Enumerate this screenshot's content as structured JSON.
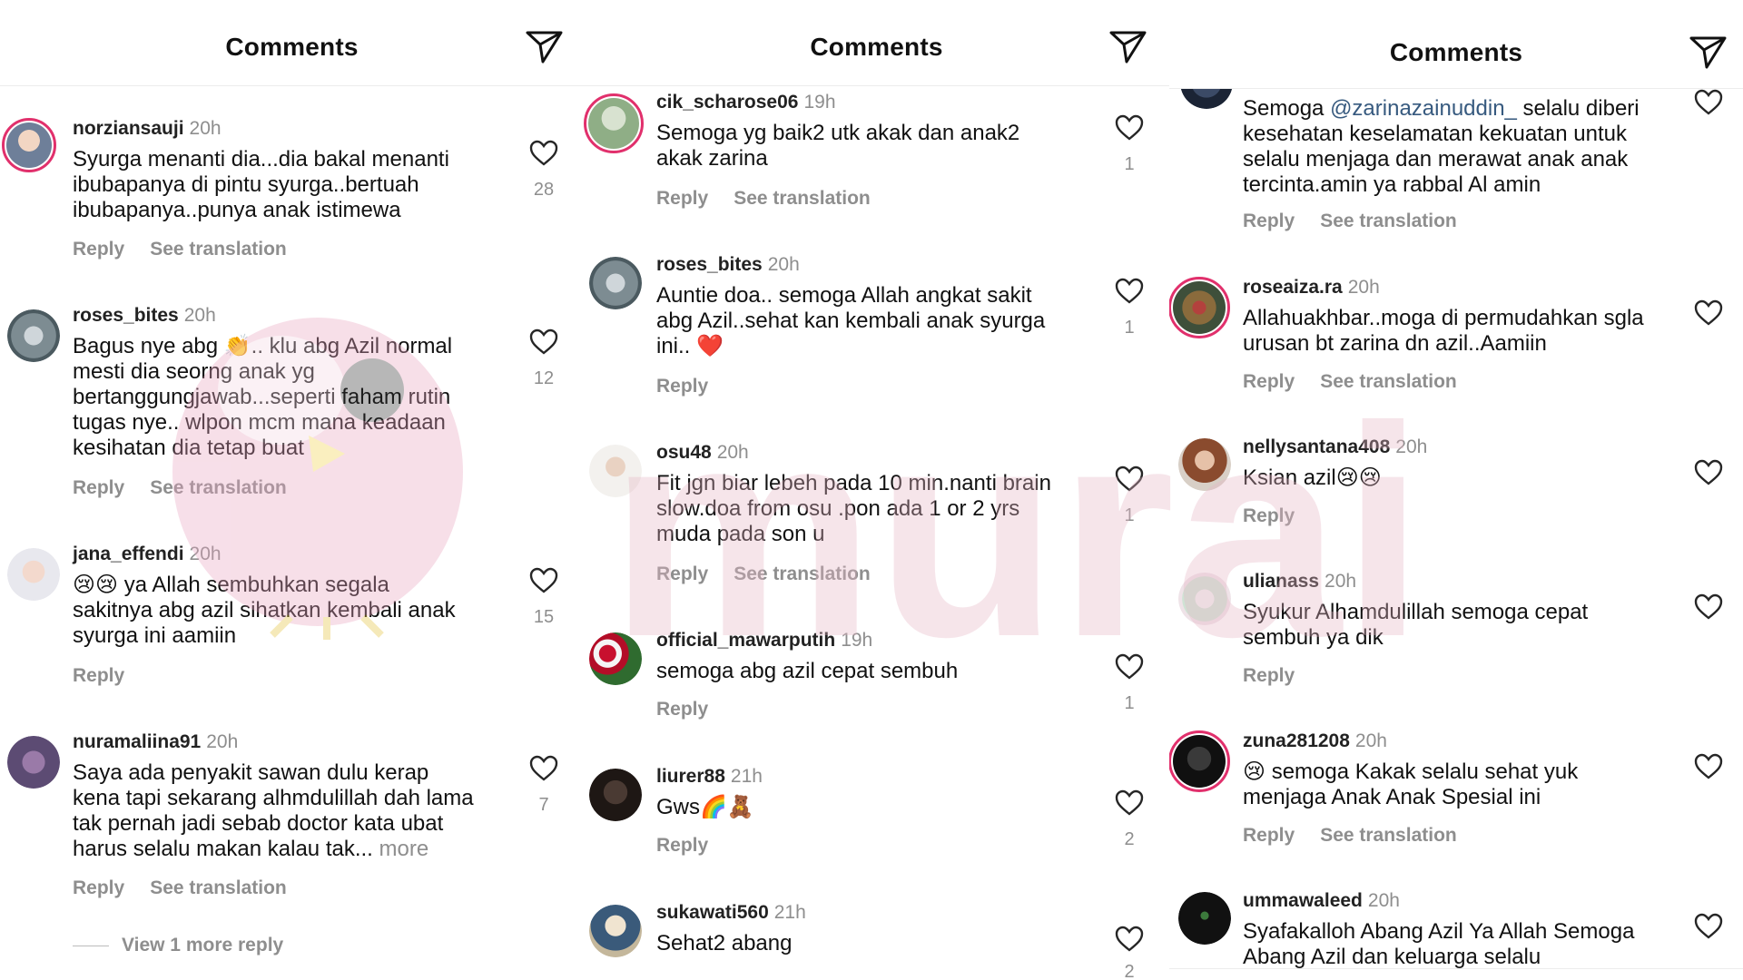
{
  "panels": [
    {
      "title": "Comments",
      "comments": [
        {
          "username": "norziansauji",
          "time": "20h",
          "text": [
            "Syurga menanti dia...dia bakal menanti",
            "ibubapanya di pintu syurga..bertuah",
            "ibubapanya..punya anak istimewa"
          ],
          "reply": "Reply",
          "translate": "See translation",
          "likes": "28"
        },
        {
          "username": "roses_bites",
          "time": "20h",
          "text": [
            "Bagus nye abg 👏.. klu abg Azil normal",
            "mesti dia seorng anak yg",
            "bertanggungjawab...seperti faham rutin",
            "tugas nye.. wlpon mcm mana keadaan",
            "kesihatan dia tetap buat"
          ],
          "reply": "Reply",
          "translate": "See translation",
          "likes": "12"
        },
        {
          "username": "jana_effendi",
          "time": "20h",
          "text": [
            "😢😢 ya Allah sembuhkan segala",
            "sakitnya abg azil sihatkan kembali anak",
            "syurga ini aamiin"
          ],
          "reply": "Reply",
          "translate": "",
          "likes": "15"
        },
        {
          "username": "nuramaliina91",
          "time": "20h",
          "text": [
            "Saya ada penyakit sawan dulu kerap",
            "kena tapi sekarang alhmdulillah dah lama",
            "tak pernah jadi sebab doctor kata ubat",
            "harus selalu makan kalau tak..."
          ],
          "more": "more",
          "reply": "Reply",
          "translate": "See translation",
          "likes": "7"
        }
      ],
      "view_more": "View 1 more reply"
    },
    {
      "title": "Comments",
      "comments": [
        {
          "username": "cik_scharose06",
          "time": "19h",
          "text": [
            "Semoga yg baik2 utk akak dan anak2",
            "akak zarina"
          ],
          "reply": "Reply",
          "translate": "See translation",
          "likes": "1"
        },
        {
          "username": "roses_bites",
          "time": "20h",
          "text": [
            "Auntie doa.. semoga Allah angkat sakit",
            "abg Azil..sehat kan kembali anak syurga",
            "ini.. ❤️"
          ],
          "reply": "Reply",
          "translate": "",
          "likes": "1"
        },
        {
          "username": "osu48",
          "time": "20h",
          "text": [
            "Fit jgn biar lebeh pada 10 min.nanti brain",
            "slow.doa from osu .pon ada 1 or 2 yrs",
            "muda pada son u"
          ],
          "reply": "Reply",
          "translate": "See translation",
          "likes": "1"
        },
        {
          "username": "official_mawarputih",
          "time": "19h",
          "text": [
            "semoga abg azil cepat sembuh"
          ],
          "reply": "Reply",
          "translate": "",
          "likes": "1"
        },
        {
          "username": "liurer88",
          "time": "21h",
          "text": [
            "Gws🌈🧸"
          ],
          "reply": "Reply",
          "translate": "",
          "likes": "2"
        },
        {
          "username": "sukawati560",
          "time": "21h",
          "text": [
            "Sehat2 abang"
          ],
          "reply": "",
          "translate": "",
          "likes": "2"
        }
      ]
    },
    {
      "title": "Comments",
      "comments": [
        {
          "username": "",
          "time": "",
          "text_parts": [
            "Semoga ",
            "@zarinazainuddin_",
            " selalu diberi"
          ],
          "text": [
            "kesehatan keselamatan kekuatan untuk",
            "selalu menjaga dan merawat anak anak",
            "tercinta.amin ya rabbal Al amin"
          ],
          "reply": "Reply",
          "translate": "See translation",
          "likes": ""
        },
        {
          "username": "roseaiza.ra",
          "time": "20h",
          "text": [
            "Allahuakhbar..moga di permudahkan sgla",
            "urusan bt zarina dn azil..Aamiin"
          ],
          "reply": "Reply",
          "translate": "See translation",
          "likes": ""
        },
        {
          "username": "nellysantana408",
          "time": "20h",
          "text": [
            "Ksian azil😢😢"
          ],
          "reply": "Reply",
          "translate": "",
          "likes": ""
        },
        {
          "username": "ulianass",
          "time": "20h",
          "text": [
            "Syukur Alhamdulillah semoga cepat",
            "sembuh ya dik"
          ],
          "reply": "Reply",
          "translate": "",
          "likes": ""
        },
        {
          "username": "zuna281208",
          "time": "20h",
          "text": [
            "😢 semoga Kakak selalu sehat yuk",
            "menjaga Anak Anak Spesial ini"
          ],
          "reply": "Reply",
          "translate": "See translation",
          "likes": ""
        },
        {
          "username": "ummawaleed",
          "time": "20h",
          "text": [
            "Syafakalloh Abang Azil Ya Allah Semoga",
            "Abang Azil dan keluarga selalu"
          ],
          "reply": "",
          "translate": "",
          "likes": ""
        }
      ]
    }
  ],
  "watermark": "murai",
  "colors": {
    "heart": "#262626",
    "muted": "#8e8e8e",
    "mention": "#375a7f",
    "ring": "#e1306c",
    "watermark": "#e7b6c6"
  },
  "icons": [
    "send-icon",
    "heart-icon"
  ]
}
